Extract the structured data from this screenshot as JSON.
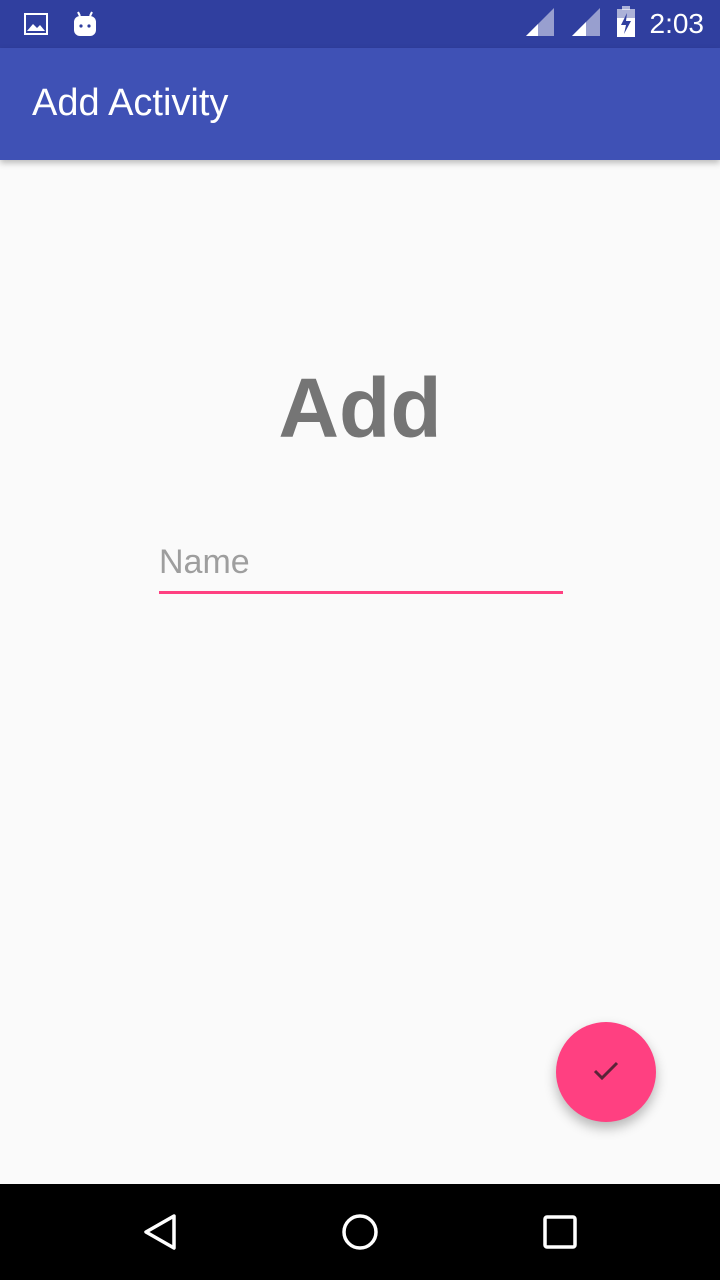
{
  "status_bar": {
    "time": "2:03",
    "icons": [
      "image-icon",
      "android-icon",
      "signal-icon",
      "signal-icon",
      "battery-charging-icon"
    ]
  },
  "app_bar": {
    "title": "Add Activity"
  },
  "main": {
    "heading": "Add",
    "name_field": {
      "placeholder": "Name",
      "value": ""
    }
  },
  "fab": {
    "icon": "check-icon"
  },
  "nav_bar": {
    "icons": [
      "back-icon",
      "home-icon",
      "recents-icon"
    ]
  },
  "colors": {
    "status_bar": "#303f9f",
    "app_bar": "#3f51b5",
    "accent": "#ff4081",
    "heading": "#757575",
    "background": "#fafafa"
  }
}
